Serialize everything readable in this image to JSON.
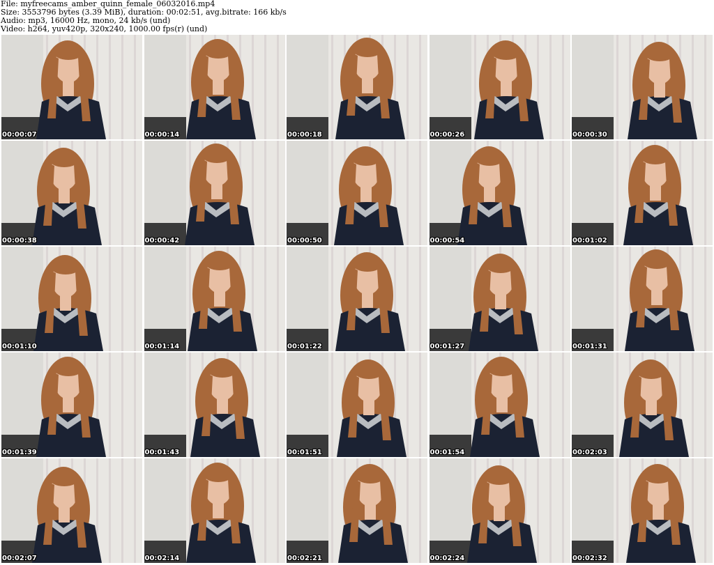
{
  "header": {
    "file": "File: myfreecams_amber_quinn_female_06032016.mp4",
    "size": "Size: 3553796 bytes (3.39 MiB), duration: 00:02:51, avg.bitrate: 166 kb/s",
    "audio": "Audio: mp3, 16000 Hz, mono, 24 kb/s (und)",
    "video": "Video: h264, yuv420p, 320x240, 1000.00 fps(r) (und)"
  },
  "thumbnails": [
    {
      "timestamp": "00:00:07"
    },
    {
      "timestamp": "00:00:14"
    },
    {
      "timestamp": "00:00:18"
    },
    {
      "timestamp": "00:00:26"
    },
    {
      "timestamp": "00:00:30"
    },
    {
      "timestamp": "00:00:38"
    },
    {
      "timestamp": "00:00:42"
    },
    {
      "timestamp": "00:00:50"
    },
    {
      "timestamp": "00:00:54"
    },
    {
      "timestamp": "00:01:02"
    },
    {
      "timestamp": "00:01:10"
    },
    {
      "timestamp": "00:01:14"
    },
    {
      "timestamp": "00:01:22"
    },
    {
      "timestamp": "00:01:27"
    },
    {
      "timestamp": "00:01:31"
    },
    {
      "timestamp": "00:01:39"
    },
    {
      "timestamp": "00:01:43"
    },
    {
      "timestamp": "00:01:51"
    },
    {
      "timestamp": "00:01:54"
    },
    {
      "timestamp": "00:02:03"
    },
    {
      "timestamp": "00:02:07"
    },
    {
      "timestamp": "00:02:14"
    },
    {
      "timestamp": "00:02:21"
    },
    {
      "timestamp": "00:02:24"
    },
    {
      "timestamp": "00:02:32"
    }
  ],
  "colors": {
    "background": "#ffffff",
    "wall": "#dcdbd7",
    "curtain": "#e9e7e3",
    "hair": "#a8683a",
    "dress": "#1b2233",
    "collar": "#b9bcc0",
    "skin": "#e8bfa4"
  }
}
